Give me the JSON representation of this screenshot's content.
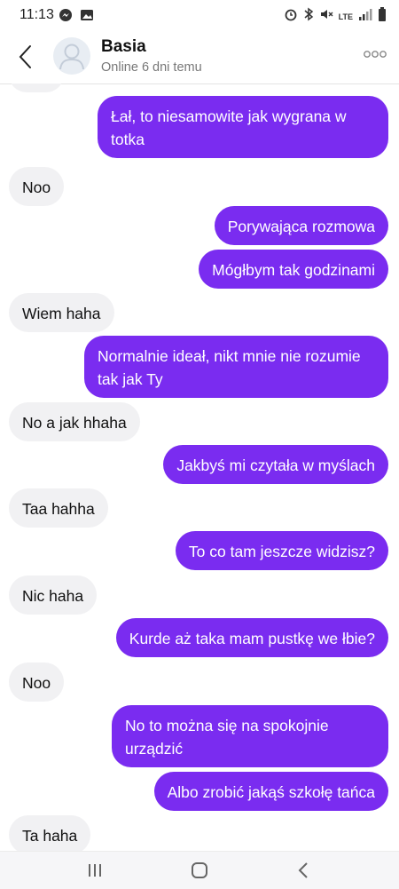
{
  "status_bar": {
    "time": "11:13",
    "network": "LTE",
    "icons": [
      "messenger-icon",
      "gallery-icon",
      "alarm-icon",
      "bluetooth-icon",
      "mute-icon",
      "signal-icon",
      "battery-icon"
    ]
  },
  "header": {
    "contact_name": "Basia",
    "status": "Online 6 dni temu"
  },
  "colors": {
    "outgoing_bubble": "#7a2cf0",
    "incoming_bubble": "#f1f1f3"
  },
  "messages": [
    {
      "dir": "out",
      "text": "Łał, to niesamowite jak wygrana w totka"
    },
    {
      "dir": "in",
      "text": "Noo"
    },
    {
      "dir": "out",
      "text": "Porywająca rozmowa"
    },
    {
      "dir": "out",
      "text": "Mógłbym tak godzinami"
    },
    {
      "dir": "in",
      "text": "Wiem haha"
    },
    {
      "dir": "out",
      "text": "Normalnie ideał, nikt mnie nie rozumie tak jak Ty"
    },
    {
      "dir": "in",
      "text": "No a jak hhaha"
    },
    {
      "dir": "out",
      "text": "Jakbyś mi czytała w myślach"
    },
    {
      "dir": "in",
      "text": "Taa hahha"
    },
    {
      "dir": "out",
      "text": "To co tam jeszcze widzisz?"
    },
    {
      "dir": "in",
      "text": "Nic haha"
    },
    {
      "dir": "out",
      "text": "Kurde aż taka mam pustkę we łbie?"
    },
    {
      "dir": "in",
      "text": "Noo"
    },
    {
      "dir": "out",
      "text": "No to można się na spokojnie urządzić"
    },
    {
      "dir": "out",
      "text": "Albo zrobić jakąś szkołę tańca"
    },
    {
      "dir": "in",
      "text": "Ta haha"
    }
  ]
}
